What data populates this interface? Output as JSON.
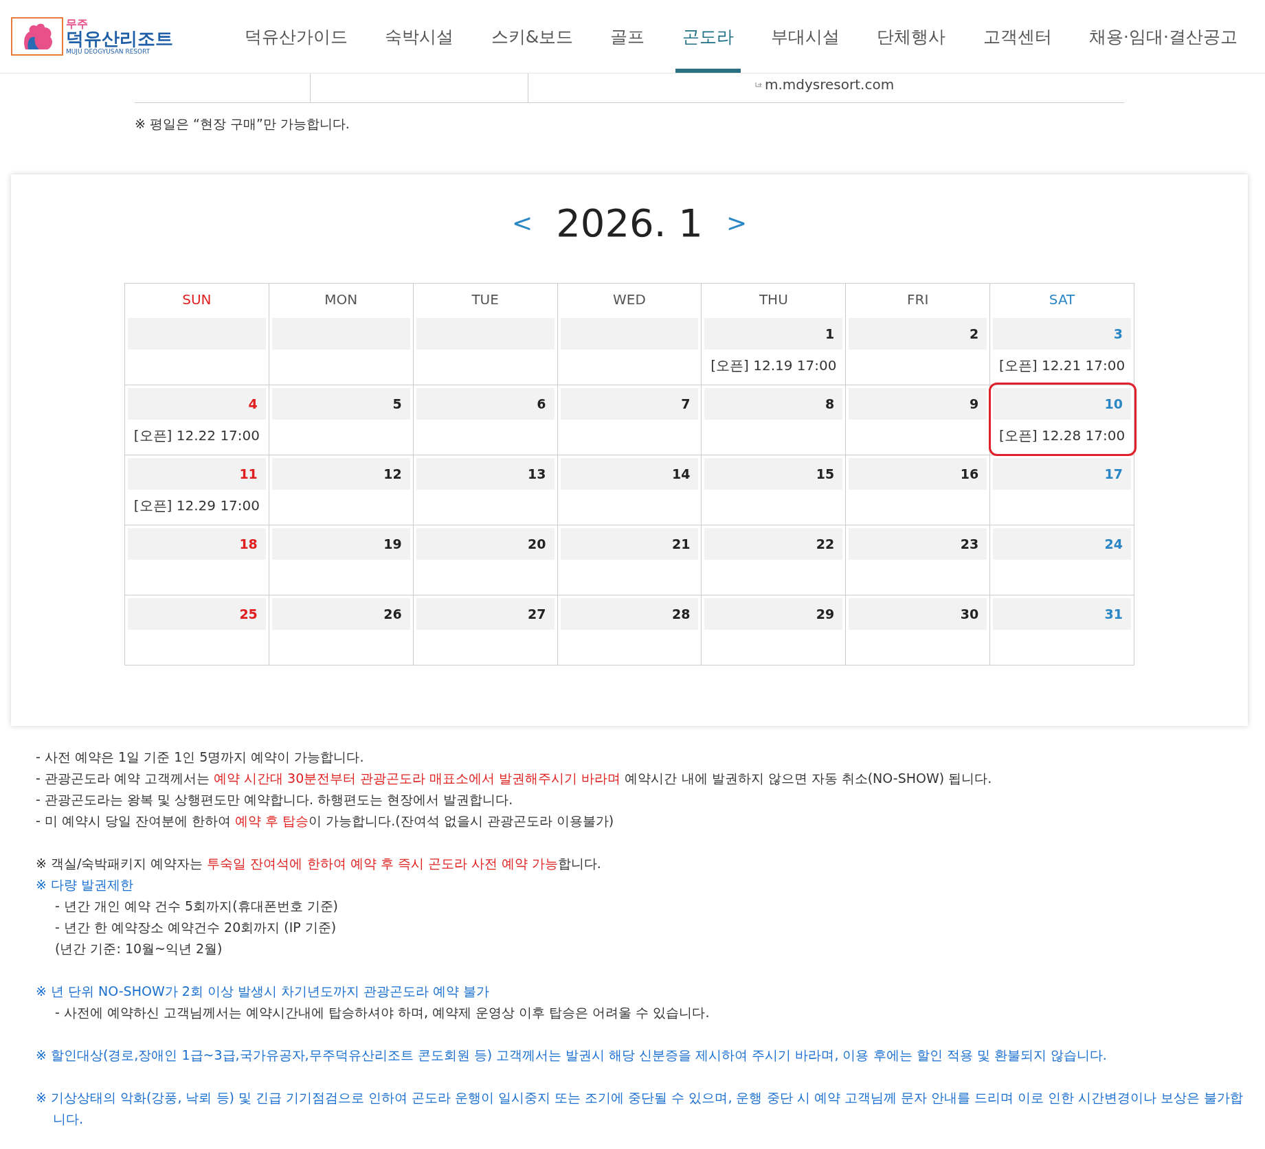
{
  "header": {
    "logo": {
      "top": "무주",
      "main": "덕유산리조트",
      "sub": "MUJU DEOGYUSAN RESORT"
    },
    "nav": [
      {
        "label": "덕유산가이드",
        "selected": false
      },
      {
        "label": "숙박시설",
        "selected": false
      },
      {
        "label": "스키&보드",
        "selected": false
      },
      {
        "label": "골프",
        "selected": false
      },
      {
        "label": "곤도라",
        "selected": true
      },
      {
        "label": "부대시설",
        "selected": false
      },
      {
        "label": "단체행사",
        "selected": false
      },
      {
        "label": "고객센터",
        "selected": false
      },
      {
        "label": "채용·임대·결산공고",
        "selected": false
      }
    ]
  },
  "info_table": {
    "link": "m.mdysresort.com"
  },
  "weekday_note": "※ 평일은 “현장 구매”만 가능합니다.",
  "calendar": {
    "prev": "<",
    "title": "2026. 1",
    "next": ">",
    "weekdays": [
      "SUN",
      "MON",
      "TUE",
      "WED",
      "THU",
      "FRI",
      "SAT"
    ],
    "weeks": [
      [
        {
          "kind": "blank"
        },
        {
          "kind": "blank"
        },
        {
          "kind": "blank"
        },
        {
          "kind": "blank"
        },
        {
          "kind": "day",
          "day": "1",
          "open": "[오픈] 12.19 17:00",
          "highlighted": false
        },
        {
          "kind": "day",
          "day": "2",
          "highlighted": false
        },
        {
          "kind": "day",
          "day": "3",
          "open": "[오픈] 12.21 17:00",
          "highlighted": false
        }
      ],
      [
        {
          "kind": "day",
          "day": "4",
          "open": "[오픈] 12.22 17:00",
          "highlighted": false
        },
        {
          "kind": "day",
          "day": "5",
          "highlighted": false
        },
        {
          "kind": "day",
          "day": "6",
          "highlighted": false
        },
        {
          "kind": "day",
          "day": "7",
          "highlighted": false
        },
        {
          "kind": "day",
          "day": "8",
          "highlighted": false
        },
        {
          "kind": "day",
          "day": "9",
          "highlighted": false
        },
        {
          "kind": "day",
          "day": "10",
          "open": "[오픈] 12.28 17:00",
          "highlighted": true
        }
      ],
      [
        {
          "kind": "day",
          "day": "11",
          "open": "[오픈] 12.29 17:00",
          "highlighted": false
        },
        {
          "kind": "day",
          "day": "12",
          "highlighted": false
        },
        {
          "kind": "day",
          "day": "13",
          "highlighted": false
        },
        {
          "kind": "day",
          "day": "14",
          "highlighted": false
        },
        {
          "kind": "day",
          "day": "15",
          "highlighted": false
        },
        {
          "kind": "day",
          "day": "16",
          "highlighted": false
        },
        {
          "kind": "day",
          "day": "17",
          "highlighted": false
        }
      ],
      [
        {
          "kind": "day",
          "day": "18",
          "highlighted": false
        },
        {
          "kind": "day",
          "day": "19",
          "highlighted": false
        },
        {
          "kind": "day",
          "day": "20",
          "highlighted": false
        },
        {
          "kind": "day",
          "day": "21",
          "highlighted": false
        },
        {
          "kind": "day",
          "day": "22",
          "highlighted": false
        },
        {
          "kind": "day",
          "day": "23",
          "highlighted": false
        },
        {
          "kind": "day",
          "day": "24",
          "highlighted": false
        }
      ],
      [
        {
          "kind": "day",
          "day": "25",
          "highlighted": false
        },
        {
          "kind": "day",
          "day": "26",
          "highlighted": false
        },
        {
          "kind": "day",
          "day": "27",
          "highlighted": false
        },
        {
          "kind": "day",
          "day": "28",
          "highlighted": false
        },
        {
          "kind": "day",
          "day": "29",
          "highlighted": false
        },
        {
          "kind": "day",
          "day": "30",
          "highlighted": false
        },
        {
          "kind": "day",
          "day": "31",
          "highlighted": false
        }
      ]
    ]
  },
  "notes": [
    [
      {
        "kind": "item",
        "parts": [
          {
            "text": "- 사전 예약은 1일 기준 1인 5명까지 예약이 가능합니다.",
            "emphasis": false
          }
        ]
      },
      {
        "kind": "item",
        "parts": [
          {
            "text": "- 관광곤도라 예약 고객께서는 ",
            "emphasis": false
          },
          {
            "text": "예약 시간대 30분전부터 관광곤도라 매표소에서 발권해주시기 바라며",
            "emphasis": true
          },
          {
            "text": " 예약시간 내에 발권하지 않으면 자동 취소(NO-SHOW) 됩니다.",
            "emphasis": false
          }
        ]
      },
      {
        "kind": "item",
        "parts": [
          {
            "text": "- 관광곤도라는 왕복 및 상행편도만 예약합니다. 하행편도는 현장에서 발권합니다.",
            "emphasis": false
          }
        ]
      },
      {
        "kind": "item",
        "parts": [
          {
            "text": "- 미 예약시 당일 잔여분에 한하여 ",
            "emphasis": false
          },
          {
            "text": "예약 후 탑승",
            "emphasis": true
          },
          {
            "text": "이 가능합니다.(잔여석 없을시 관광곤도라 이용불가)",
            "emphasis": false
          }
        ]
      }
    ],
    [
      {
        "kind": "item",
        "parts": [
          {
            "text": "※ 객실/숙박패키지 예약자는 ",
            "emphasis": false
          },
          {
            "text": "투숙일 잔여석에 한하여 예약 후 즉시 곤도라 사전 예약 가능",
            "emphasis": true
          },
          {
            "text": "합니다.",
            "emphasis": false
          }
        ]
      },
      {
        "kind": "notice",
        "parts": [
          {
            "text": "※ 다량 발권제한",
            "emphasis": false
          }
        ],
        "children": [
          {
            "kind": "item",
            "parts": [
              {
                "text": "- 년간 개인 예약 건수 5회까지(휴대폰번호 기준)",
                "emphasis": false
              }
            ]
          },
          {
            "kind": "item",
            "parts": [
              {
                "text": "- 년간 한 예약장소 예약건수 20회까지 (IP 기준)",
                "emphasis": false
              }
            ]
          },
          {
            "kind": "item",
            "parts": [
              {
                "text": " (년간 기준: 10월~익년 2월)",
                "emphasis": false
              }
            ]
          }
        ]
      }
    ],
    [
      {
        "kind": "notice",
        "parts": [
          {
            "text": "※ 년 단위 NO-SHOW가 2회 이상 발생시 차기년도까지 관광곤도라 예약 불가",
            "emphasis": false
          }
        ],
        "children": [
          {
            "kind": "item",
            "parts": [
              {
                "text": "- 사전에 예약하신 고객님께서는 예약시간내에 탑승하셔야 하며, 예약제 운영상 이후 탑승은 어려울 수 있습니다.",
                "emphasis": false
              }
            ]
          }
        ]
      }
    ],
    [
      {
        "kind": "notice",
        "parts": [
          {
            "text": "※ 할인대상(경로,장애인 1급~3급,국가유공자,무주덕유산리조트 콘도회원 등) 고객께서는 발권시 해당 신분증을 제시하여 주시기 바라며, 이용 후에는 할인 적용 및 환불되지 않습니다.",
            "emphasis": false
          }
        ]
      }
    ],
    [
      {
        "kind": "notice",
        "parts": [
          {
            "text": "※  기상상태의 악화(강풍, 낙뢰 등) 및 긴급 기기점검으로 인하여 곤도라 운행이 일시중지 또는 조기에 중단될 수 있으며, 운행 중단 시 예약 고객님께 문자 안내를 드리며 이로 인한 시간변경이나 보상은 불가합니다.",
            "emphasis": false
          }
        ]
      }
    ]
  ]
}
